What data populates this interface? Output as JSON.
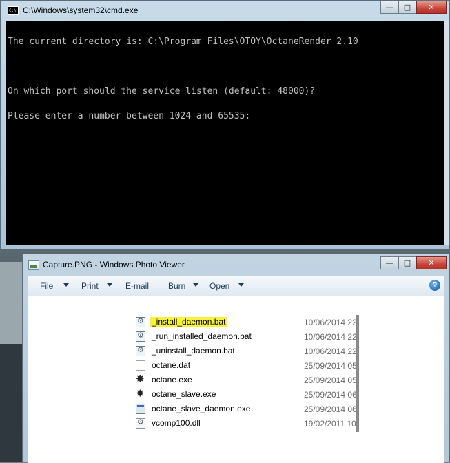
{
  "cmd": {
    "title": "C:\\Windows\\system32\\cmd.exe",
    "icon_text": "C:\\",
    "lines": [
      "The current directory is: C:\\Program Files\\OTOY\\OctaneRender 2.10",
      "",
      "On which port should the service listen (default: 48000)?",
      "Please enter a number between 1024 and 65535:"
    ],
    "controls": {
      "minimize": "—",
      "maximize": "□",
      "close": "✕"
    }
  },
  "viewer": {
    "title": "Capture.PNG - Windows Photo Viewer",
    "controls": {
      "minimize": "—",
      "maximize": "□",
      "close": "✕"
    },
    "menu": [
      {
        "label": "File",
        "has_arrow": true
      },
      {
        "label": "Print",
        "has_arrow": true
      },
      {
        "label": "E-mail",
        "has_arrow": false
      },
      {
        "label": "Burn",
        "has_arrow": true
      },
      {
        "label": "Open",
        "has_arrow": true
      }
    ],
    "help_label": "?",
    "files": [
      {
        "name": "_install_daemon.bat",
        "date": "10/06/2014 22:",
        "icon": "bat-file-icon",
        "highlight": true
      },
      {
        "name": "_run_installed_daemon.bat",
        "date": "10/06/2014 22:",
        "icon": "bat-file-icon",
        "highlight": false
      },
      {
        "name": "_uninstall_daemon.bat",
        "date": "10/06/2014 22:",
        "icon": "bat-file-icon",
        "highlight": false
      },
      {
        "name": "octane.dat",
        "date": "25/09/2014 05:",
        "icon": "blank-file-icon",
        "highlight": false
      },
      {
        "name": "octane.exe",
        "date": "25/09/2014 05:",
        "icon": "octane-exe-icon",
        "highlight": false
      },
      {
        "name": "octane_slave.exe",
        "date": "25/09/2014 06:",
        "icon": "octane-exe-icon",
        "highlight": false
      },
      {
        "name": "octane_slave_daemon.exe",
        "date": "25/09/2014 06:",
        "icon": "window-exe-icon",
        "highlight": false
      },
      {
        "name": "vcomp100.dll",
        "date": "19/02/2011 10:",
        "icon": "dll-file-icon",
        "highlight": false
      }
    ]
  },
  "colors": {
    "console_bg": "#000000",
    "console_text": "#c0c0c0",
    "highlight": "#f8f23a",
    "close_button": "#c8453a"
  }
}
